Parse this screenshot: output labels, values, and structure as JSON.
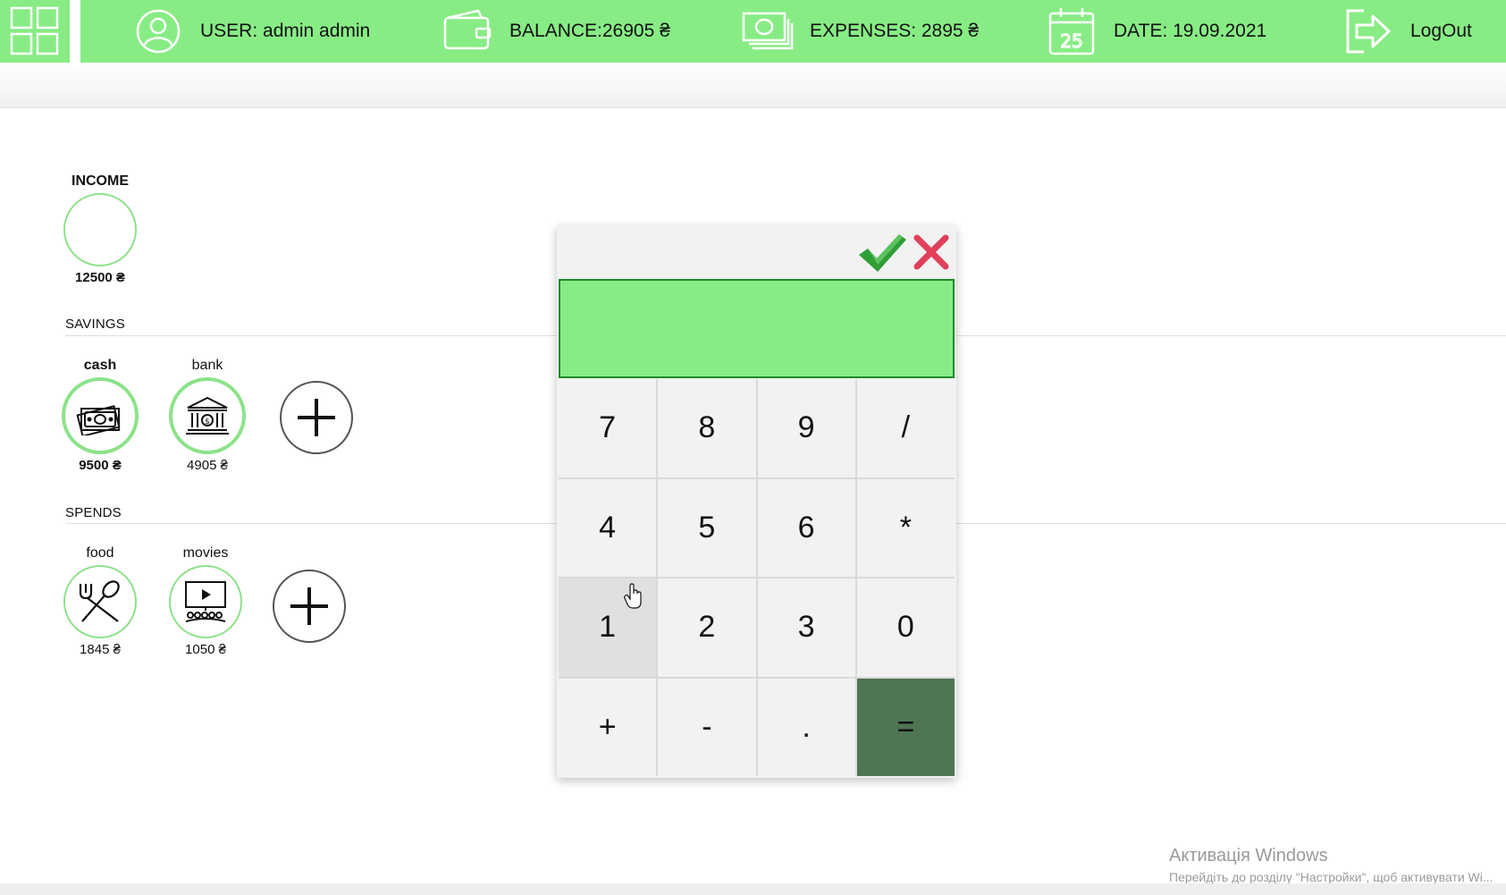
{
  "header": {
    "user": "USER: admin admin",
    "balance": "BALANCE:26905 ₴",
    "expenses": "EXPENSES: 2895 ₴",
    "date": "DATE: 19.09.2021",
    "logout": "LogOut",
    "calendar_day": "25",
    "accent_color": "#88ec85"
  },
  "income": {
    "title": "INCOME",
    "amount": "12500 ₴"
  },
  "savings": {
    "title": "SAVINGS",
    "items": [
      {
        "name": "cash",
        "amount": "9500 ₴",
        "icon": "cash-icon"
      },
      {
        "name": "bank",
        "amount": "4905 ₴",
        "icon": "bank-icon"
      }
    ]
  },
  "spends": {
    "title": "SPENDS",
    "items": [
      {
        "name": "food",
        "amount": "1845 ₴",
        "icon": "fork-spoon-icon"
      },
      {
        "name": "movies",
        "amount": "1050 ₴",
        "icon": "cinema-icon"
      }
    ]
  },
  "calculator": {
    "display": "",
    "keys": [
      "7",
      "8",
      "9",
      "/",
      "4",
      "5",
      "6",
      "*",
      "1",
      "2",
      "3",
      "0",
      "+",
      "-",
      ".",
      "="
    ],
    "equals_color": "#4f7554",
    "confirm_color": "#2f9e35",
    "cancel_color": "#e0405a"
  },
  "watermark": {
    "line1": "Активація Windows",
    "line2": "Перейдіть до розділу \"Настройки\", щоб активувати Wi..."
  }
}
